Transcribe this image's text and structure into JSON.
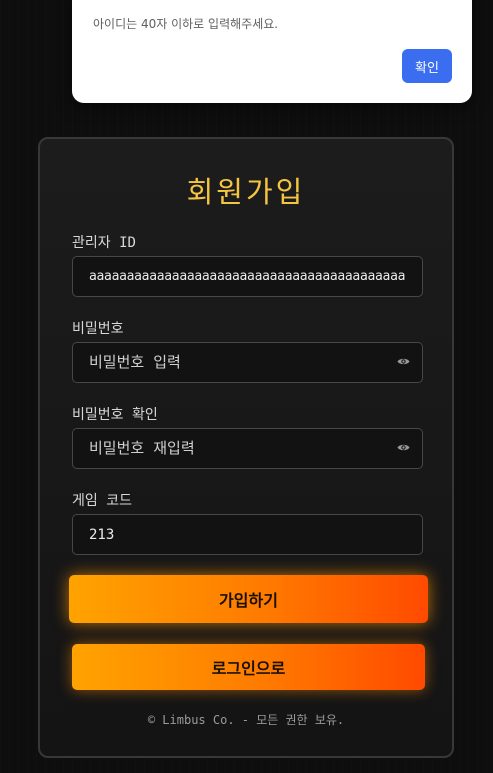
{
  "alert": {
    "message": "아이디는 40자 이하로 입력해주세요.",
    "ok_label": "확인"
  },
  "signup": {
    "title": "회원가입",
    "admin_id": {
      "label": "관리자 ID",
      "value": "aaaaaaaaaaaaaaaaaaaaaaaaaaaaaaaaaaaaaaaaaa"
    },
    "password": {
      "label": "비밀번호",
      "placeholder": "비밀번호 입력",
      "icon": "eye-icon"
    },
    "password_confirm": {
      "label": "비밀번호 확인",
      "placeholder": "비밀번호 재입력",
      "icon": "eye-icon"
    },
    "game_code": {
      "label": "게임 코드",
      "value": "213"
    },
    "signup_button": "가입하기",
    "login_button": "로그인으로",
    "footer": "© Limbus Co. - 모든 권한 보유."
  },
  "colors": {
    "accent_title": "#f5c542",
    "button_gradient_start": "#ffa300",
    "button_gradient_end": "#ff4a00",
    "alert_button": "#3a6df0"
  }
}
